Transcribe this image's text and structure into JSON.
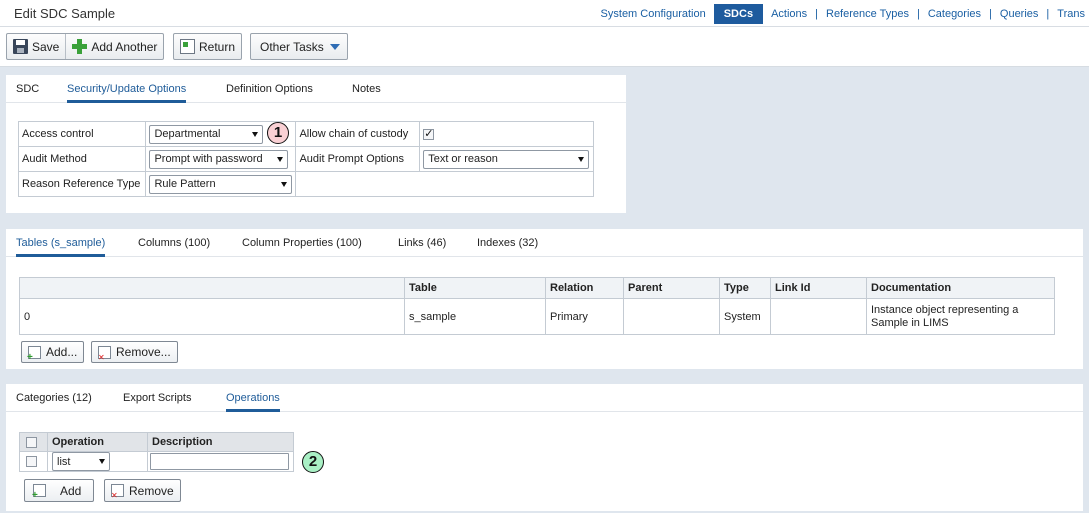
{
  "page": {
    "title": "Edit SDC Sample"
  },
  "nav": {
    "items": [
      {
        "label": "System Configuration"
      },
      {
        "label": "SDCs"
      },
      {
        "label": "Actions"
      },
      {
        "label": "Reference Types"
      },
      {
        "label": "Categories"
      },
      {
        "label": "Queries"
      },
      {
        "label": "Trans"
      }
    ],
    "separator": "|"
  },
  "toolbar": {
    "save": "Save",
    "add_another": "Add Another",
    "return": "Return",
    "other_tasks": "Other Tasks"
  },
  "security_panel": {
    "tabs": [
      "SDC",
      "Security/Update Options",
      "Definition Options",
      "Notes"
    ],
    "active_tab": "Security/Update Options",
    "fields": {
      "access_control": {
        "label": "Access control",
        "value": "Departmental"
      },
      "audit_method": {
        "label": "Audit Method",
        "value": "Prompt with password"
      },
      "reason_reference_type": {
        "label": "Reason Reference Type",
        "value": "Rule Pattern"
      },
      "allow_chain_of_custody": {
        "label": "Allow chain of custody",
        "checked": true
      },
      "audit_prompt_options": {
        "label": "Audit Prompt Options",
        "value": "Text or reason"
      }
    },
    "callout": "1"
  },
  "tables_panel": {
    "tabs": [
      "Tables (s_sample)",
      "Columns (100)",
      "Column Properties (100)",
      "Links (46)",
      "Indexes (32)"
    ],
    "active_tab": "Tables (s_sample)",
    "columns": [
      "",
      "Table",
      "Relation",
      "Parent",
      "Type",
      "Link Id",
      "Documentation"
    ],
    "rows": [
      [
        "0",
        "s_sample",
        "Primary",
        "",
        "System",
        "",
        "Instance object representing a Sample in LIMS"
      ]
    ],
    "add_button": "Add...",
    "remove_button": "Remove..."
  },
  "operations_panel": {
    "tabs": [
      "Categories (12)",
      "Export Scripts",
      "Operations"
    ],
    "active_tab": "Operations",
    "columns": [
      "Operation",
      "Description"
    ],
    "rows": [
      {
        "operation": "list",
        "description": ""
      }
    ],
    "add_button": "Add",
    "remove_button": "Remove",
    "callout": "2"
  }
}
